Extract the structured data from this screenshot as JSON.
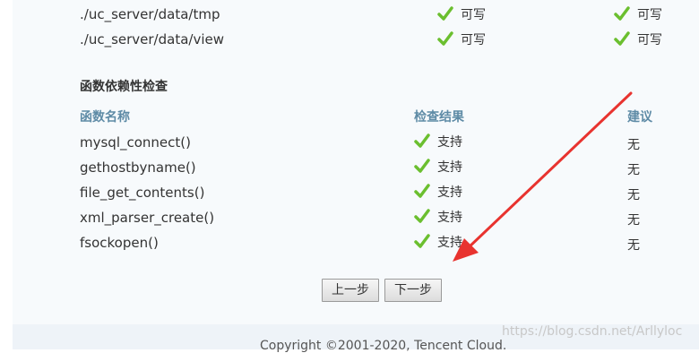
{
  "dir_rows": [
    {
      "path": "./uc_server/data/tmp",
      "current": "可写",
      "required": "可写"
    },
    {
      "path": "./uc_server/data/view",
      "current": "可写",
      "required": "可写"
    }
  ],
  "func_section": {
    "title": "函数依赖性检查",
    "headers": {
      "name": "函数名称",
      "result": "检查结果",
      "suggestion": "建议"
    },
    "rows": [
      {
        "name": "mysql_connect()",
        "result": "支持",
        "suggestion": "无"
      },
      {
        "name": "gethostbyname()",
        "result": "支持",
        "suggestion": "无"
      },
      {
        "name": "file_get_contents()",
        "result": "支持",
        "suggestion": "无"
      },
      {
        "name": "xml_parser_create()",
        "result": "支持",
        "suggestion": "无"
      },
      {
        "name": "fsockopen()",
        "result": "支持",
        "suggestion": "无"
      }
    ]
  },
  "buttons": {
    "prev": "上一步",
    "next": "下一步"
  },
  "footer": {
    "copyright": "Copyright ©2001-2020, Tencent Cloud."
  },
  "watermark": "https://blog.csdn.net/Arllyloc",
  "colors": {
    "check": "#6bbf2f",
    "header": "#5e8ba6",
    "arrow": "#e8332f"
  },
  "icons": {
    "check": "check-icon",
    "annotation": "red-arrow-annotation"
  }
}
